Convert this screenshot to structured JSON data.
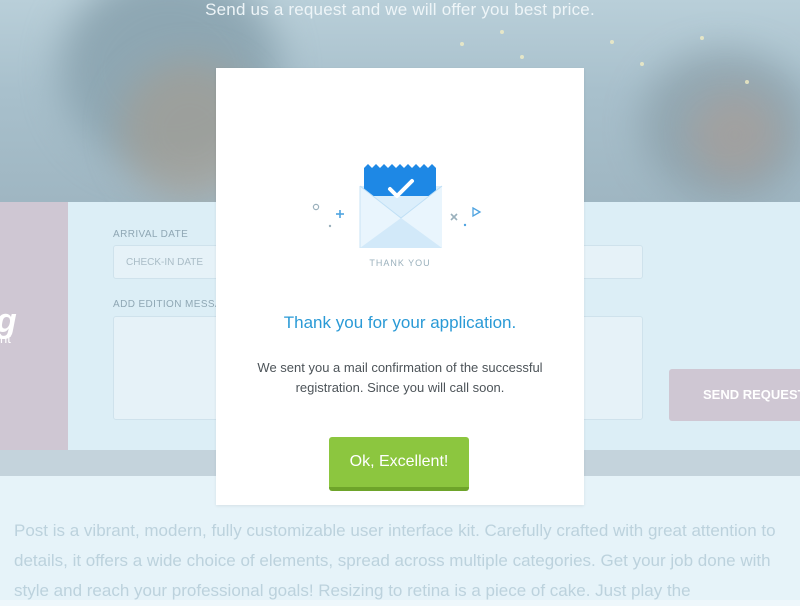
{
  "hero": {
    "subtitle": "Send us a request and we will offer you best price."
  },
  "brand": {
    "tagline": "nt"
  },
  "form": {
    "arrival_label": "ARRIVAL DATE",
    "arrival_placeholder": "CHECK-IN DATE",
    "message_label": "ADD EDITION MESSA",
    "send_label": "SEND REQUEST"
  },
  "content": {
    "paragraph": "Post is a vibrant, modern, fully customizable user interface kit. Carefully crafted with great attention to details, it offers a wide choice of elements, spread across multiple categories. Get your job done with style and reach your professional goals! Resizing to retina is a piece of cake. Just play the"
  },
  "modal": {
    "illustration_caption": "THANK YOU",
    "title": "Thank you for your application.",
    "message": "We sent you a mail confirmation of the successful registration. Since you will call soon.",
    "ok_label": "Ok, Excellent!"
  },
  "colors": {
    "accent_blue": "#2a9ad6",
    "button_green": "#8cc63f",
    "envelope_blue": "#1e88e5"
  },
  "icons": [
    "envelope-check-icon",
    "plus-icon",
    "cross-icon",
    "play-triangle-icon",
    "circle-icon"
  ]
}
